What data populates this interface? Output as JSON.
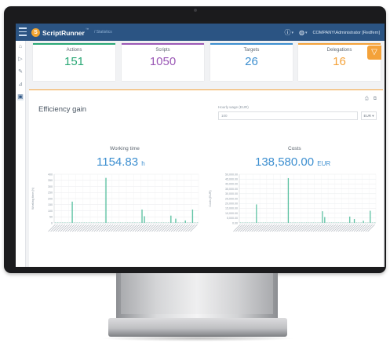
{
  "app": {
    "brand": "ScriptRunner",
    "brand_trademark": "™",
    "logo_glyph": "S",
    "breadcrumb": "/ Statistics",
    "user_company": "COMPANY\\Administrator [Redfern]"
  },
  "sidebar": {
    "items": [
      {
        "icon": "home-icon",
        "glyph": "⌂"
      },
      {
        "icon": "play-icon",
        "glyph": "▷"
      },
      {
        "icon": "wrench-icon",
        "glyph": "✎"
      },
      {
        "icon": "chart-icon",
        "glyph": "⊿"
      },
      {
        "icon": "image-icon",
        "glyph": "▣"
      }
    ]
  },
  "cards": [
    {
      "label": "Actions",
      "value": "151",
      "color": "#2aa876"
    },
    {
      "label": "Scripts",
      "value": "1050",
      "color": "#9b59b6"
    },
    {
      "label": "Targets",
      "value": "26",
      "color": "#3d8fd0"
    },
    {
      "label": "Delegations",
      "value": "16",
      "color": "#f4a23a"
    }
  ],
  "panel": {
    "title": "Efficiency gain",
    "hourly_label": "Hourly wage (EUR)",
    "hourly_value": "100",
    "currency": "EUR ▾"
  },
  "working_time": {
    "title": "Working time",
    "value": "1154.83",
    "unit": "h"
  },
  "costs": {
    "title": "Costs",
    "value": "138,580.00",
    "unit": "EUR"
  },
  "chart_data": [
    {
      "type": "bar",
      "title": "Working time",
      "ylabel": "Working time (h)",
      "ylim": [
        0,
        400
      ],
      "yticks": [
        "400",
        "350",
        "300",
        "250",
        "200",
        "150",
        "100",
        "50",
        "0"
      ],
      "categories": [
        "c1",
        "c2",
        "c3",
        "c4",
        "c5",
        "c6",
        "c7",
        "c8",
        "c9",
        "c10",
        "c11",
        "c12",
        "c13",
        "c14",
        "c15",
        "c16",
        "c17",
        "c18",
        "c19",
        "c20",
        "c21",
        "c22",
        "c23",
        "c24",
        "c25",
        "c26",
        "c27",
        "c28",
        "c29",
        "c30",
        "c31",
        "c32",
        "c33",
        "c34",
        "c35",
        "c36",
        "c37",
        "c38",
        "c39",
        "c40",
        "c41",
        "c42",
        "c43",
        "c44",
        "c45",
        "c46",
        "c47",
        "c48",
        "c49",
        "c50",
        "c51",
        "c52",
        "c53",
        "c54",
        "c55",
        "c56",
        "c57",
        "c58",
        "c59",
        "c60"
      ],
      "values": [
        0,
        0,
        0,
        2,
        0,
        0,
        1,
        175,
        0,
        0,
        0,
        0,
        1,
        0,
        0,
        0,
        0,
        0,
        1,
        0,
        0,
        370,
        0,
        0,
        0,
        0,
        1,
        0,
        0,
        0,
        1,
        0,
        0,
        0,
        0,
        0,
        110,
        55,
        0,
        0,
        0,
        0,
        0,
        1,
        0,
        0,
        0,
        2,
        60,
        0,
        35,
        0,
        0,
        0,
        20,
        0,
        0,
        110,
        0,
        0
      ]
    },
    {
      "type": "bar",
      "title": "Costs",
      "ylabel": "Costs (EUR)",
      "ylim": [
        0,
        50000
      ],
      "yticks": [
        "50,000.00",
        "45,000.00",
        "40,000.00",
        "35,000.00",
        "30,000.00",
        "25,000.00",
        "20,000.00",
        "15,000.00",
        "10,000.00",
        "5,000.00",
        "0.00"
      ],
      "categories": [
        "c1",
        "c2",
        "c3",
        "c4",
        "c5",
        "c6",
        "c7",
        "c8",
        "c9",
        "c10",
        "c11",
        "c12",
        "c13",
        "c14",
        "c15",
        "c16",
        "c17",
        "c18",
        "c19",
        "c20",
        "c21",
        "c22",
        "c23",
        "c24",
        "c25",
        "c26",
        "c27",
        "c28",
        "c29",
        "c30",
        "c31",
        "c32",
        "c33",
        "c34",
        "c35",
        "c36",
        "c37",
        "c38",
        "c39",
        "c40",
        "c41",
        "c42",
        "c43",
        "c44",
        "c45",
        "c46",
        "c47",
        "c48",
        "c49",
        "c50",
        "c51",
        "c52",
        "c53",
        "c54",
        "c55",
        "c56",
        "c57",
        "c58",
        "c59",
        "c60"
      ],
      "values": [
        0,
        0,
        0,
        300,
        0,
        0,
        200,
        19000,
        0,
        0,
        0,
        0,
        200,
        0,
        0,
        0,
        0,
        0,
        200,
        0,
        0,
        46000,
        0,
        0,
        0,
        0,
        200,
        0,
        0,
        0,
        200,
        0,
        0,
        0,
        0,
        0,
        12000,
        6000,
        0,
        0,
        0,
        0,
        0,
        200,
        0,
        0,
        0,
        300,
        6500,
        0,
        4000,
        0,
        0,
        0,
        2200,
        0,
        0,
        12500,
        0,
        0
      ]
    }
  ]
}
